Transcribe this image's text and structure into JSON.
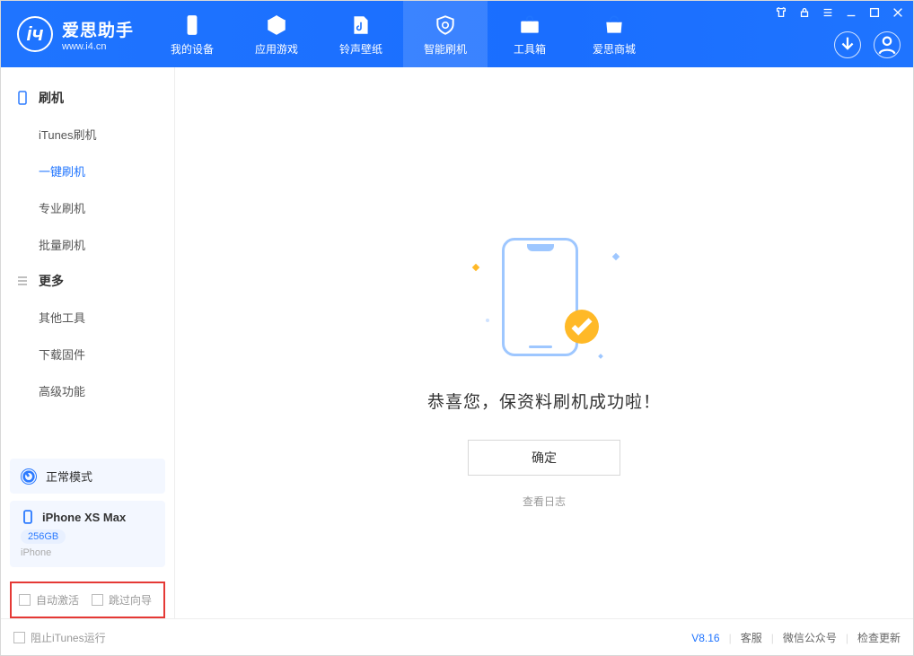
{
  "app": {
    "name_cn": "爱思助手",
    "url": "www.i4.cn"
  },
  "nav": {
    "items": [
      {
        "label": "我的设备"
      },
      {
        "label": "应用游戏"
      },
      {
        "label": "铃声壁纸"
      },
      {
        "label": "智能刷机"
      },
      {
        "label": "工具箱"
      },
      {
        "label": "爱思商城"
      }
    ],
    "active_index": 3
  },
  "sidebar": {
    "section_flash": "刷机",
    "flash_items": [
      {
        "label": "iTunes刷机"
      },
      {
        "label": "一键刷机"
      },
      {
        "label": "专业刷机"
      },
      {
        "label": "批量刷机"
      }
    ],
    "flash_active_index": 1,
    "section_more": "更多",
    "more_items": [
      {
        "label": "其他工具"
      },
      {
        "label": "下载固件"
      },
      {
        "label": "高级功能"
      }
    ],
    "mode_label": "正常模式",
    "device": {
      "name": "iPhone XS Max",
      "capacity": "256GB",
      "type": "iPhone"
    },
    "options": {
      "auto_activate": "自动激活",
      "skip_wizard": "跳过向导"
    }
  },
  "main": {
    "success_msg": "恭喜您，保资料刷机成功啦！",
    "ok_button": "确定",
    "view_log": "查看日志"
  },
  "footer": {
    "block_itunes": "阻止iTunes运行",
    "version": "V8.16",
    "support": "客服",
    "wechat": "微信公众号",
    "check_update": "检查更新"
  }
}
